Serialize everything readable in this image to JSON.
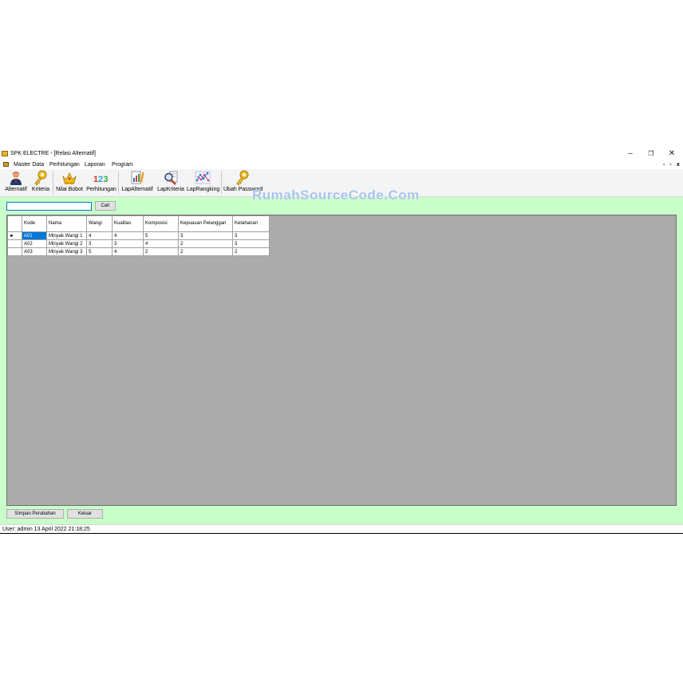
{
  "window": {
    "title": "SPK ELECTRE - [Relasi Alternatif]",
    "controls": {
      "minimize": "–",
      "restore": "❐",
      "close": "✕"
    }
  },
  "menubar": {
    "items": [
      "Master Data",
      "Perhitungan",
      "Laporan",
      "Program"
    ],
    "mdi_controls": {
      "minimize": "-",
      "restore": "▫",
      "close": "x"
    }
  },
  "toolbar": {
    "buttons": [
      {
        "label": "Alternatif",
        "icon": "user-icon"
      },
      {
        "label": "Kriteria",
        "icon": "key-icon"
      },
      {
        "label": "Nilai Bobot",
        "icon": "crown-icon"
      },
      {
        "label": "Perhitungan",
        "icon": "numbers-123-icon"
      },
      {
        "label": "LapAlternatif",
        "icon": "report-chart-icon"
      },
      {
        "label": "LapKriteria",
        "icon": "magnifier-report-icon"
      },
      {
        "label": "LapRangking",
        "icon": "network-chart-icon"
      },
      {
        "label": "Ubah Password",
        "icon": "key-icon"
      }
    ]
  },
  "search": {
    "value": "",
    "button_label": "Cari"
  },
  "table": {
    "columns": [
      "Kode",
      "Nama",
      "Wangi",
      "Kualitas",
      "Komposisi",
      "Kepuasan Pelanggan",
      "Ketahanan"
    ],
    "current_row_marker": "►",
    "rows": [
      [
        "A01",
        "Minyak Wangi 1",
        "4",
        "4",
        "5",
        "3",
        "3"
      ],
      [
        "A02",
        "Minyak Wangi 2",
        "3",
        "3",
        "4",
        "2",
        "3"
      ],
      [
        "A03",
        "Minyak Wangi 3",
        "5",
        "4",
        "2",
        "2",
        "2"
      ]
    ]
  },
  "watermark": "RumahSourceCode.Com",
  "buttons": {
    "save": "Simpan Perubahan",
    "exit": "Keluar"
  },
  "status": {
    "text": "User: admin  13 April 2022 21:18:25"
  },
  "colors": {
    "content_bg": "#c9ffc9",
    "grid_bg": "#ababab",
    "selection": "#0078d7",
    "watermark": "#a8c4ea"
  }
}
